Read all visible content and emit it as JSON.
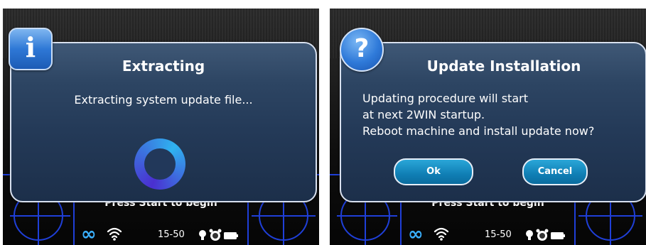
{
  "screens": [
    {
      "dialog": {
        "badge_icon": "info-icon",
        "badge_glyph": "i",
        "title": "Extracting",
        "message": "Extracting system update file..."
      },
      "footer": {
        "prompt": "Press Start to begin"
      },
      "status": {
        "link_icon": "infinity-link-icon",
        "wifi_icon": "wifi-icon",
        "time": "15-50",
        "icons": [
          "bulb-icon",
          "alarm-clock-icon",
          "battery-icon"
        ]
      }
    },
    {
      "dialog": {
        "badge_icon": "question-icon",
        "badge_glyph": "?",
        "title": "Update Installation",
        "message_lines": [
          "Updating procedure will start",
          "at next 2WIN startup.",
          "Reboot machine and install update now?"
        ],
        "ok_label": "Ok",
        "cancel_label": "Cancel"
      },
      "footer": {
        "prompt": "Press Start to begin"
      },
      "status": {
        "link_icon": "infinity-link-icon",
        "wifi_icon": "wifi-icon",
        "time": "15-50",
        "icons": [
          "bulb-icon",
          "alarm-clock-icon",
          "battery-icon"
        ]
      }
    }
  ],
  "colors": {
    "dialog_bg": "#2d4563",
    "button_bg": "#107fb5",
    "grid_line": "#1f3fd8",
    "status_link": "#3ab0ff"
  }
}
